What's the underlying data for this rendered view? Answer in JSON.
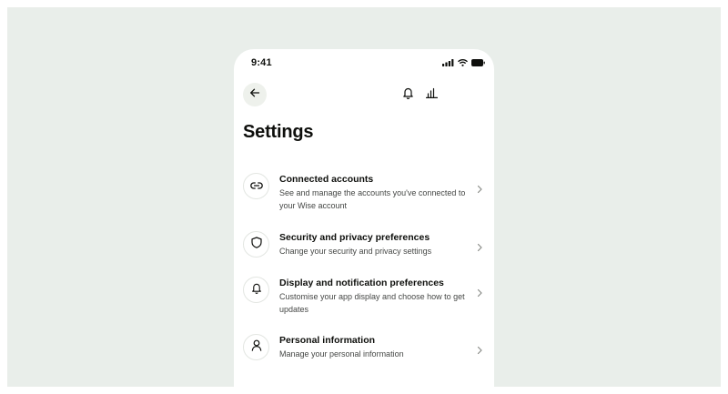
{
  "status_bar": {
    "time": "9:41"
  },
  "page": {
    "title": "Settings"
  },
  "items": [
    {
      "title": "Connected accounts",
      "description": "See and manage the accounts you've connected to your Wise account",
      "icon": "link-icon"
    },
    {
      "title": "Security and privacy preferences",
      "description": "Change your security and privacy settings",
      "icon": "shield-icon"
    },
    {
      "title": "Display and notification preferences",
      "description": "Customise your app display and choose how to get updates",
      "icon": "bell-icon"
    },
    {
      "title": "Personal information",
      "description": "Manage your personal information",
      "icon": "user-icon"
    }
  ],
  "colors": {
    "background": "#e9eeea",
    "back_button_bg": "#eef1ec",
    "text": "#0e0f0c",
    "secondary_text": "#454745"
  }
}
